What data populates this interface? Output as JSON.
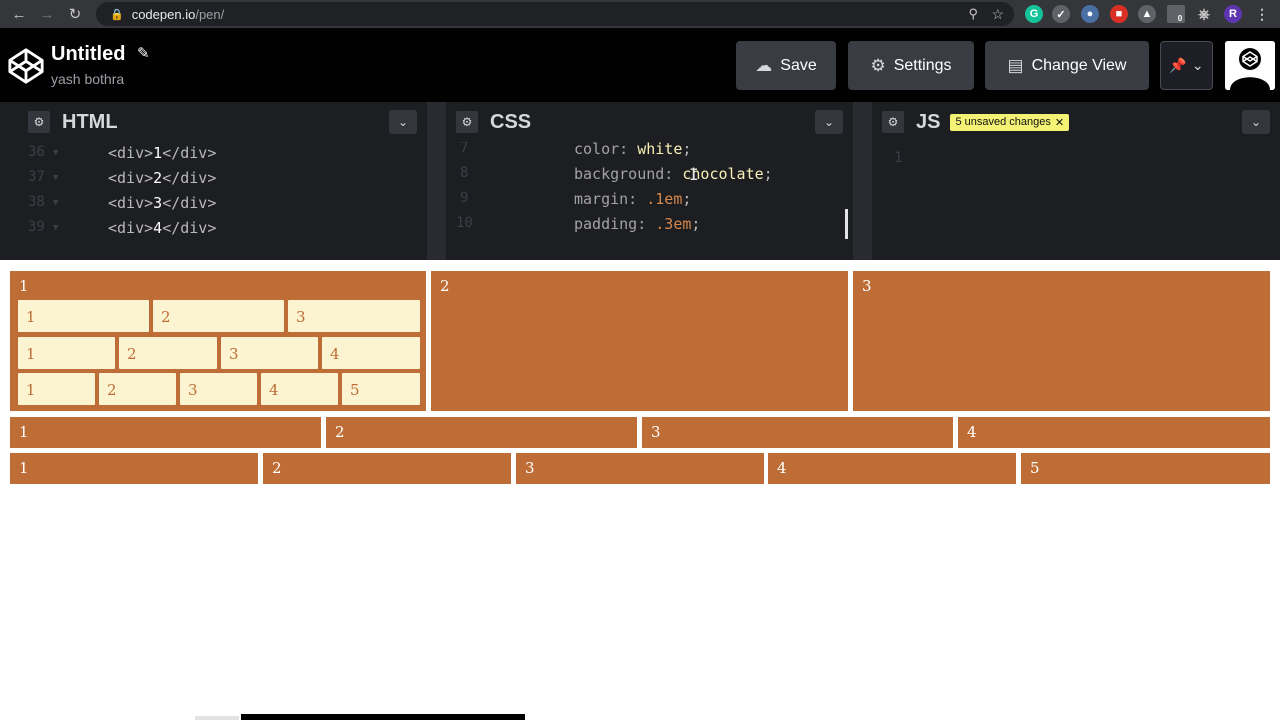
{
  "browser": {
    "url_host": "codepen.io",
    "url_path": "/pen/",
    "extension_badge": "0",
    "profile_initial": "R",
    "extensions_g": "G"
  },
  "header": {
    "pen_title": "Untitled",
    "author": "yash bothra",
    "save_label": "Save",
    "settings_label": "Settings",
    "change_view_label": "Change View"
  },
  "panes": {
    "html": {
      "title": "HTML",
      "lines": [
        {
          "num": "36",
          "open": "<div>",
          "text": "1",
          "close": "</div>"
        },
        {
          "num": "37",
          "open": "<div>",
          "text": "2",
          "close": "</div>"
        },
        {
          "num": "38",
          "open": "<div>",
          "text": "3",
          "close": "</div>"
        },
        {
          "num": "39",
          "open": "<div>",
          "text": "4",
          "close": "</div>"
        }
      ]
    },
    "css": {
      "title": "CSS",
      "lines": [
        {
          "num": "7",
          "prop": "color:",
          "value": "white",
          "end": ";"
        },
        {
          "num": "8",
          "prop": "background:",
          "value": "chocolate",
          "end": ";"
        },
        {
          "num": "9",
          "prop": "margin:",
          "value": ".1em",
          "end": ";"
        },
        {
          "num": "10",
          "prop": "padding:",
          "value": ".3em",
          "end": ";"
        }
      ]
    },
    "js": {
      "title": "JS",
      "badge": "5 unsaved changes",
      "line_num": "1"
    }
  },
  "preview": {
    "row1": [
      "1",
      "2",
      "3"
    ],
    "nested_row_a": [
      "1",
      "2",
      "3"
    ],
    "nested_row_b": [
      "1",
      "2",
      "3",
      "4"
    ],
    "nested_row_c": [
      "1",
      "2",
      "3",
      "4",
      "5"
    ],
    "row2": [
      "1",
      "2",
      "3",
      "4"
    ],
    "row3": [
      "1",
      "2",
      "3",
      "4",
      "5"
    ]
  },
  "colors": {
    "chocolate": "#bd6d35",
    "inner_bg": "#fcf3d0",
    "editor_bg": "#1d1e22",
    "header_bg": "#010101",
    "badge_bg": "#f4f275"
  }
}
